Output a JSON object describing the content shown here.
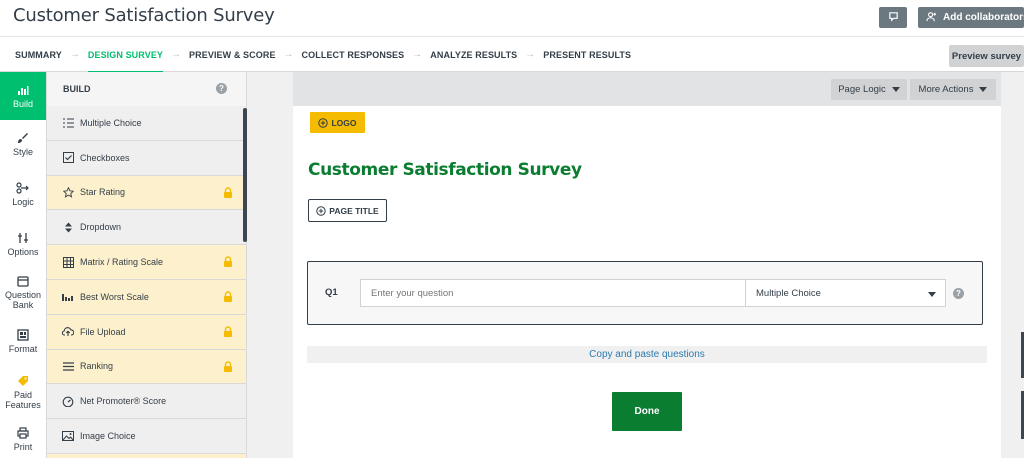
{
  "header": {
    "title": "Customer Satisfaction Survey",
    "add_collaborators_label": "Add collaborators",
    "comment_icon": "comment-icon",
    "add_user_icon": "add-user-icon"
  },
  "nav": {
    "steps": [
      {
        "label": "SUMMARY",
        "active": false
      },
      {
        "label": "DESIGN SURVEY",
        "active": true
      },
      {
        "label": "PREVIEW & SCORE",
        "active": false
      },
      {
        "label": "COLLECT RESPONSES",
        "active": false
      },
      {
        "label": "ANALYZE RESULTS",
        "active": false
      },
      {
        "label": "PRESENT RESULTS",
        "active": false
      }
    ],
    "arrow": "→",
    "preview_label": "Preview survey"
  },
  "rail": {
    "items": [
      {
        "label": "Build",
        "icon": "build-icon",
        "active": true
      },
      {
        "label": "Style",
        "icon": "brush-icon"
      },
      {
        "label": "Logic",
        "icon": "logic-icon"
      },
      {
        "label": "Options",
        "icon": "options-icon"
      },
      {
        "label": "Question Bank",
        "icon": "question-bank-icon"
      },
      {
        "label": "Format",
        "icon": "format-icon"
      },
      {
        "label": "Paid Features",
        "icon": "tag-icon"
      },
      {
        "label": "Print",
        "icon": "print-icon"
      }
    ]
  },
  "build": {
    "heading": "BUILD",
    "help": "?",
    "question_types": [
      {
        "label": "Multiple Choice",
        "icon": "list-icon",
        "locked": false
      },
      {
        "label": "Checkboxes",
        "icon": "checkbox-icon",
        "locked": false
      },
      {
        "label": "Star Rating",
        "icon": "star-icon",
        "locked": true
      },
      {
        "label": "Dropdown",
        "icon": "dropdown-icon",
        "locked": false
      },
      {
        "label": "Matrix / Rating Scale",
        "icon": "matrix-icon",
        "locked": true
      },
      {
        "label": "Best Worst Scale",
        "icon": "bar-scale-icon",
        "locked": true
      },
      {
        "label": "File Upload",
        "icon": "upload-icon",
        "locked": true
      },
      {
        "label": "Ranking",
        "icon": "ranking-icon",
        "locked": true
      },
      {
        "label": "Net Promoter® Score",
        "icon": "gauge-icon",
        "locked": false
      },
      {
        "label": "Image Choice",
        "icon": "image-icon",
        "locked": false
      }
    ]
  },
  "toolbar": {
    "page_logic": "Page Logic",
    "more_actions": "More Actions"
  },
  "canvas": {
    "logo_label": "LOGO",
    "survey_title": "Customer Satisfaction Survey",
    "page_title_label": "PAGE TITLE",
    "question": {
      "number": "Q1",
      "placeholder": "Enter your question",
      "type_selected": "Multiple Choice",
      "help": "?"
    },
    "copy_paste_label": "Copy and paste questions",
    "done_label": "Done"
  },
  "colors": {
    "brand_green": "#00bf6f",
    "title_green": "#0a7d31",
    "logo_yellow": "#f4bb00",
    "locked_bg": "#fdf1cd"
  }
}
